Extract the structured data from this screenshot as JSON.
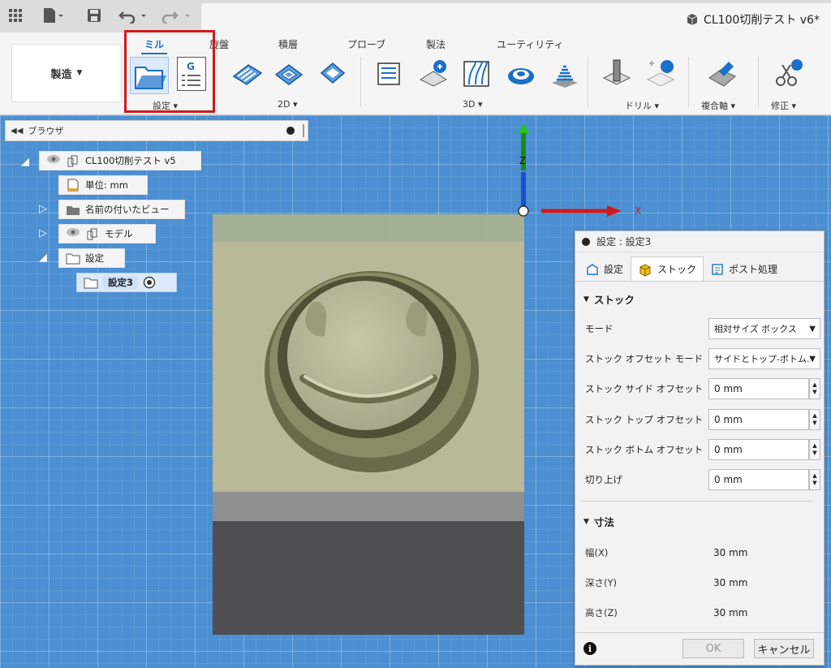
{
  "app": {
    "document_title": "CL100切削テスト v6*"
  },
  "ribbon": {
    "workspace_label": "製造",
    "tabs": [
      "ミル",
      "旋盤",
      "積層",
      "プローブ",
      "製法",
      "ユーティリティ"
    ],
    "groups": [
      "設定",
      "2D",
      "3D",
      "ドリル",
      "複合軸",
      "修正"
    ]
  },
  "browser": {
    "header_label": "ブラウザ",
    "nodes": [
      "CL100切削テスト v5",
      "単位: mm",
      "名前の付いたビュー",
      "モデル",
      "設定",
      "設定3"
    ]
  },
  "dialog": {
    "title": "設定 : 設定3",
    "tabs": [
      "設定",
      "ストック",
      "ポスト処理"
    ],
    "stock_section": "ストック",
    "fields": [
      {
        "label": "モード",
        "value": "相対サイズ ボックス"
      },
      {
        "label": "ストック オフセット モード",
        "value": "サイドとトップ-ボトム..."
      },
      {
        "label": "ストック サイド オフセット",
        "value": "0 mm"
      },
      {
        "label": "ストック トップ オフセット",
        "value": "0 mm"
      },
      {
        "label": "ストック ボトム オフセット",
        "value": "0 mm"
      },
      {
        "label": "切り上げ",
        "value": "0 mm"
      }
    ],
    "dimensions_section": "寸法",
    "dimensions": [
      {
        "label": "幅(X)",
        "value": "30 mm"
      },
      {
        "label": "深さ(Y)",
        "value": "30 mm"
      },
      {
        "label": "高さ(Z)",
        "value": "30 mm"
      }
    ],
    "ok_label": "OK",
    "cancel_label": "キャンセル"
  },
  "viewport": {
    "axis_z": "Z",
    "axis_x": "X"
  },
  "colors": {
    "accent": "#1a6fc9",
    "highlight": "#d11a1a",
    "viewport_bg": "#4c8fd2"
  }
}
